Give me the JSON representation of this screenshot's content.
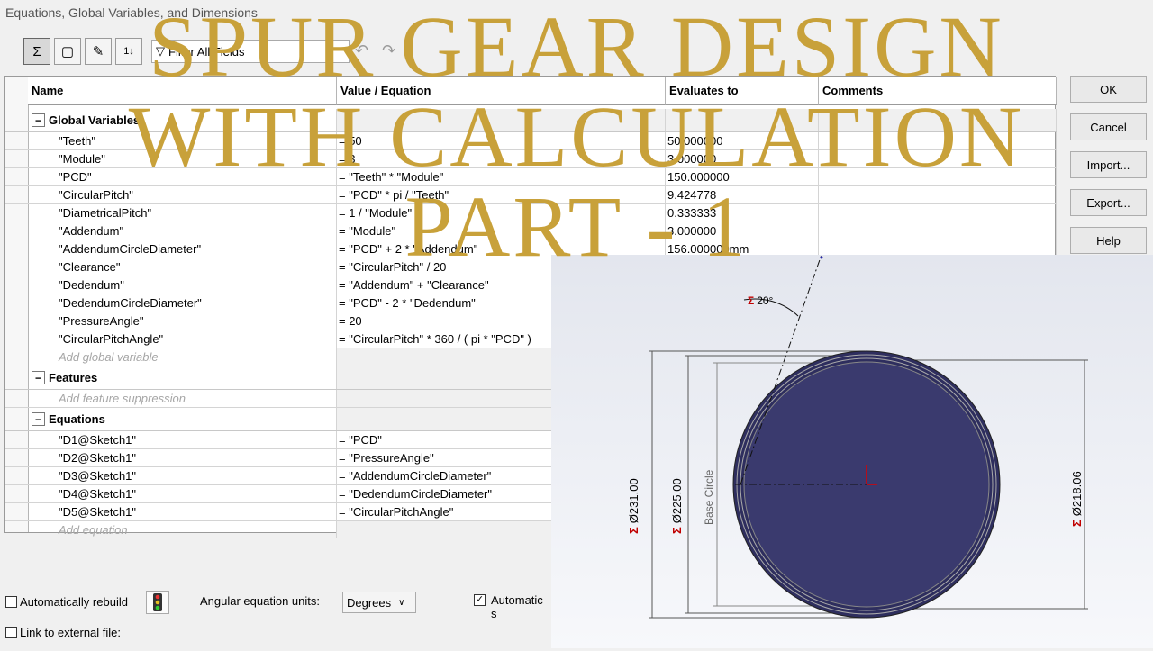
{
  "window": {
    "title": "Equations, Global Variables, and Dimensions"
  },
  "toolbar": {
    "filter_placeholder": "Filter All Fields",
    "buttons": [
      "sigma-icon",
      "equation-view-icon",
      "sketch-equation-icon",
      "sort-icon"
    ]
  },
  "table": {
    "headers": {
      "name": "Name",
      "value": "Value / Equation",
      "evaluates": "Evaluates to",
      "comments": "Comments"
    },
    "global_section": "Global Variables",
    "global_rows": [
      {
        "name": "\"Teeth\"",
        "value": "= 50",
        "eval": "50.000000"
      },
      {
        "name": "\"Module\"",
        "value": "= 3",
        "eval": "3.000000"
      },
      {
        "name": "\"PCD\"",
        "value": "= \"Teeth\" * \"Module\"",
        "eval": "150.000000"
      },
      {
        "name": "\"CircularPitch\"",
        "value": "= \"PCD\" * pi / \"Teeth\"",
        "eval": "9.424778"
      },
      {
        "name": "\"DiametricalPitch\"",
        "value": "= 1 / \"Module\"",
        "eval": "0.333333"
      },
      {
        "name": "\"Addendum\"",
        "value": "= \"Module\"",
        "eval": "3.000000"
      },
      {
        "name": "\"AddendumCircleDiameter\"",
        "value": "= \"PCD\" + 2 * \"Addendum\"",
        "eval": "156.000000mm"
      },
      {
        "name": "\"Clearance\"",
        "value": "= \"CircularPitch\" / 20",
        "eval": ""
      },
      {
        "name": "\"Dedendum\"",
        "value": "= \"Addendum\" + \"Clearance\"",
        "eval": ""
      },
      {
        "name": "\"DedendumCircleDiameter\"",
        "value": "= \"PCD\" - 2 * \"Dedendum\"",
        "eval": ""
      },
      {
        "name": "\"PressureAngle\"",
        "value": "= 20",
        "eval": ""
      },
      {
        "name": "\"CircularPitchAngle\"",
        "value": "= \"CircularPitch\" * 360 / ( pi * \"PCD\" )",
        "eval": ""
      }
    ],
    "add_global": "Add global variable",
    "features_section": "Features",
    "add_feature": "Add feature suppression",
    "equations_section": "Equations",
    "equation_rows": [
      {
        "name": "\"D1@Sketch1\"",
        "value": "= \"PCD\""
      },
      {
        "name": "\"D2@Sketch1\"",
        "value": "= \"PressureAngle\""
      },
      {
        "name": "\"D3@Sketch1\"",
        "value": "= \"AddendumCircleDiameter\""
      },
      {
        "name": "\"D4@Sketch1\"",
        "value": "= \"DedendumCircleDiameter\""
      },
      {
        "name": "\"D5@Sketch1\"",
        "value": "= \"CircularPitchAngle\""
      }
    ],
    "add_equation": "Add equation"
  },
  "side_buttons": {
    "ok": "OK",
    "cancel": "Cancel",
    "import": "Import...",
    "export": "Export...",
    "help": "Help"
  },
  "bottom": {
    "auto_rebuild": "Automatically rebuild",
    "auto_rebuild_checked": false,
    "angular_units_label": "Angular equation units:",
    "angular_units_value": "Degrees",
    "automatic_label": "Automatic s",
    "automatic_checked": true,
    "link_external": "Link to external file:",
    "link_checked": false
  },
  "cad": {
    "angle_label": "20°",
    "dim_231": "Ø231.00",
    "dim_225": "Ø225.00",
    "dim_218": "Ø218.06",
    "base_circle": "Base Circle",
    "gear_fill": "#3a3a6e",
    "dim_color": "#c00000"
  },
  "overlay": {
    "line1": "SPUR GEAR DESIGN",
    "line2": "WITH CALCULATION",
    "line3": "PART - 1",
    "color": "#c8a13a"
  }
}
